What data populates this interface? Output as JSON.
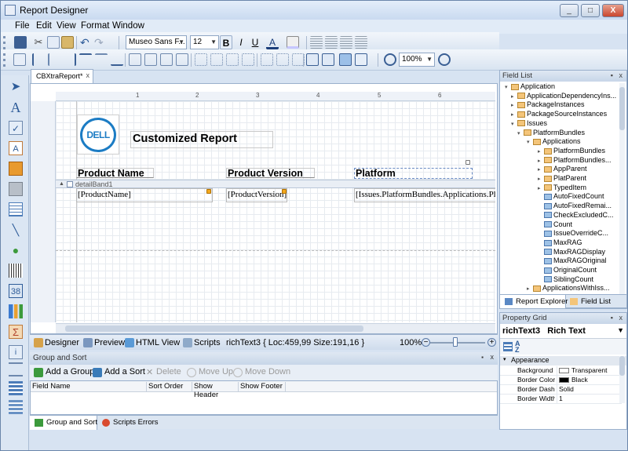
{
  "window": {
    "title": "Report Designer",
    "controls": [
      "_",
      "□",
      "X"
    ]
  },
  "menu": [
    "File",
    "Edit",
    "View",
    "Format",
    "Window"
  ],
  "toolbar": {
    "font_name": "Museo Sans F...",
    "font_size": "12",
    "bold": "B",
    "italic": "I",
    "underline": "U",
    "font_color_glyph": "A",
    "zoom": "100%"
  },
  "document_tab": {
    "label": "CBXtraReport*",
    "close": "x"
  },
  "ruler_marks": [
    "1",
    "2",
    "3",
    "4",
    "5",
    "6"
  ],
  "report": {
    "logo_text": "DELL",
    "title": "Customized Report",
    "headers": [
      "Product Name",
      "Product Version",
      "Platform"
    ],
    "band_name": "detailBand1",
    "fields": [
      "[ProductName]",
      "[ProductVersion]",
      "[Issues.PlatformBundles.Applications.Platf"
    ]
  },
  "statusbar": {
    "tabs": [
      "Designer",
      "Preview",
      "HTML View",
      "Scripts"
    ],
    "selection_info": "richText3 { Loc:459,99 Size:191,16 }",
    "zoom": "100%",
    "zoom_level": 0.45
  },
  "group_sort": {
    "title": "Group and Sort",
    "actions": [
      {
        "label": "Add a Group",
        "enabled": true
      },
      {
        "label": "Add a Sort",
        "enabled": true
      },
      {
        "label": "Delete",
        "enabled": false
      },
      {
        "label": "Move Up",
        "enabled": false
      },
      {
        "label": "Move Down",
        "enabled": false
      }
    ],
    "columns": [
      "Field Name",
      "Sort Order",
      "Show Header",
      "Show Footer"
    ],
    "tabs": [
      "Group and Sort",
      "Scripts Errors"
    ]
  },
  "field_list": {
    "title": "Field List",
    "items": [
      {
        "label": "Application",
        "level": 0,
        "expand": "▾",
        "icon": "table"
      },
      {
        "label": "ApplicationDependencyIns...",
        "level": 1,
        "expand": "▸",
        "icon": "table"
      },
      {
        "label": "PackageInstances",
        "level": 1,
        "expand": "▸",
        "icon": "table"
      },
      {
        "label": "PackageSourceInstances",
        "level": 1,
        "expand": "▸",
        "icon": "table"
      },
      {
        "label": "Issues",
        "level": 1,
        "expand": "▾",
        "icon": "table"
      },
      {
        "label": "PlatformBundles",
        "level": 2,
        "expand": "▾",
        "icon": "table"
      },
      {
        "label": "Applications",
        "level": 3,
        "expand": "▾",
        "icon": "table"
      },
      {
        "label": "PlatformBundles",
        "level": 4,
        "expand": "▸",
        "icon": "table"
      },
      {
        "label": "PlatformBundles...",
        "level": 4,
        "expand": "▸",
        "icon": "table"
      },
      {
        "label": "AppParent",
        "level": 4,
        "expand": "▸",
        "icon": "table"
      },
      {
        "label": "PlatParent",
        "level": 4,
        "expand": "▸",
        "icon": "table"
      },
      {
        "label": "TypedItem",
        "level": 4,
        "expand": "▸",
        "icon": "table"
      },
      {
        "label": "AutoFixedCount",
        "level": 4,
        "expand": "",
        "icon": "field"
      },
      {
        "label": "AutoFixedRemai...",
        "level": 4,
        "expand": "",
        "icon": "field"
      },
      {
        "label": "CheckExcludedC...",
        "level": 4,
        "expand": "",
        "icon": "field"
      },
      {
        "label": "Count",
        "level": 4,
        "expand": "",
        "icon": "field"
      },
      {
        "label": "IssueOverrideC...",
        "level": 4,
        "expand": "",
        "icon": "field"
      },
      {
        "label": "MaxRAG",
        "level": 4,
        "expand": "",
        "icon": "field"
      },
      {
        "label": "MaxRAGDisplay",
        "level": 4,
        "expand": "",
        "icon": "field"
      },
      {
        "label": "MaxRAGOriginal",
        "level": 4,
        "expand": "",
        "icon": "field"
      },
      {
        "label": "OriginalCount",
        "level": 4,
        "expand": "",
        "icon": "field"
      },
      {
        "label": "SiblingCount",
        "level": 4,
        "expand": "",
        "icon": "field"
      },
      {
        "label": "ApplicationsWithIss...",
        "level": 3,
        "expand": "▸",
        "icon": "table"
      }
    ],
    "tabs": [
      "Report Explorer",
      "Field List"
    ]
  },
  "property_grid": {
    "title": "Property Grid",
    "selected_object": "richText3",
    "selected_type": "Rich Text",
    "category": "Appearance",
    "rows": [
      {
        "name": "Background C",
        "value": "Transparent",
        "swatch": "#ffffff"
      },
      {
        "name": "Border Color",
        "value": "Black",
        "swatch": "#000000"
      },
      {
        "name": "Border Dash",
        "value": "Solid",
        "swatch": ""
      },
      {
        "name": "Border Width",
        "value": "1",
        "swatch": ""
      }
    ]
  },
  "colors": {
    "accent": "#1c7cc4",
    "chrome": "#d7e3f2"
  }
}
